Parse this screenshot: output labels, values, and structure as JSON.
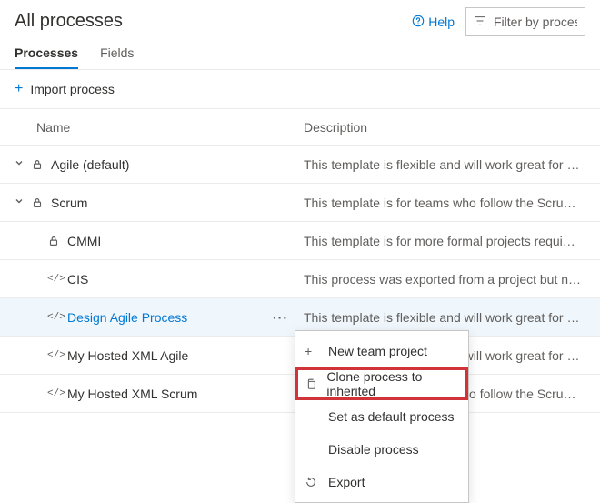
{
  "header": {
    "title": "All processes",
    "help_label": "Help",
    "filter_placeholder": "Filter by process name"
  },
  "tabs": {
    "processes": "Processes",
    "fields": "Fields"
  },
  "toolbar": {
    "import_label": "Import process"
  },
  "columns": {
    "name": "Name",
    "description": "Description"
  },
  "rows": [
    {
      "name": "Agile (default)",
      "desc": "This template is flexible and will work great for …"
    },
    {
      "name": "Scrum",
      "desc": "This template is for teams who follow the Scru…"
    },
    {
      "name": "CMMI",
      "desc": "This template is for more formal projects requi…"
    },
    {
      "name": "CIS",
      "desc": "This process was exported from a project but n…"
    },
    {
      "name": "Design Agile Process",
      "desc": "This template is flexible and will work great for …"
    },
    {
      "name": "My Hosted XML Agile",
      "desc": "This template is flexible and will work great for …"
    },
    {
      "name": "My Hosted XML Scrum",
      "desc": "This template is for teams who follow the Scru…"
    }
  ],
  "menu": {
    "new_team_project": "New team project",
    "clone_to_inherited": "Clone process to inherited",
    "set_default": "Set as default process",
    "disable": "Disable process",
    "export": "Export"
  }
}
